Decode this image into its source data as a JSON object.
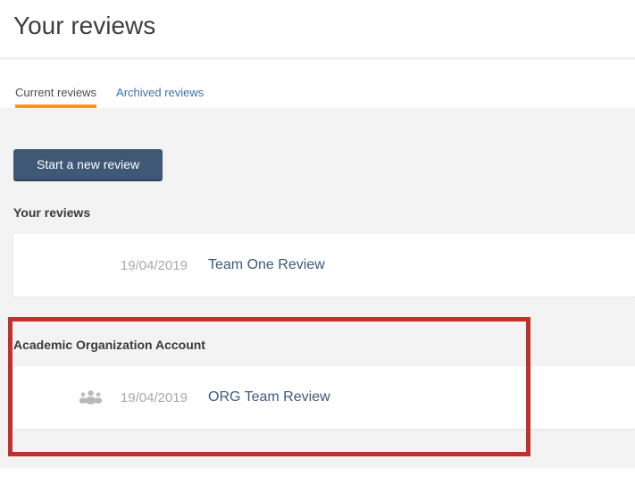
{
  "page": {
    "title": "Your reviews"
  },
  "tabs": {
    "current": "Current reviews",
    "archived": "Archived reviews"
  },
  "actions": {
    "start_review": "Start a new review"
  },
  "sections": [
    {
      "heading": "Your reviews",
      "rows": [
        {
          "date": "19/04/2019",
          "title": "Team One Review"
        }
      ]
    },
    {
      "heading": "Academic Organization Account",
      "highlighted": true,
      "rows": [
        {
          "date": "19/04/2019",
          "title": "ORG Team Review",
          "icon": "group-icon"
        }
      ]
    }
  ],
  "annotation": {
    "type": "red-highlight-box"
  },
  "colors": {
    "accent-orange": "#f7941e",
    "link-blue": "#3b73af",
    "button-bg": "#3e5876",
    "button-border": "#2c415c",
    "review-link": "#3c5a7b",
    "date-gray": "#a8a8a8",
    "icon-gray": "#b9b9b9",
    "content-bg": "#f3f3f3",
    "highlight-red": "#c0322d",
    "text-dark": "#3e3e3e"
  }
}
